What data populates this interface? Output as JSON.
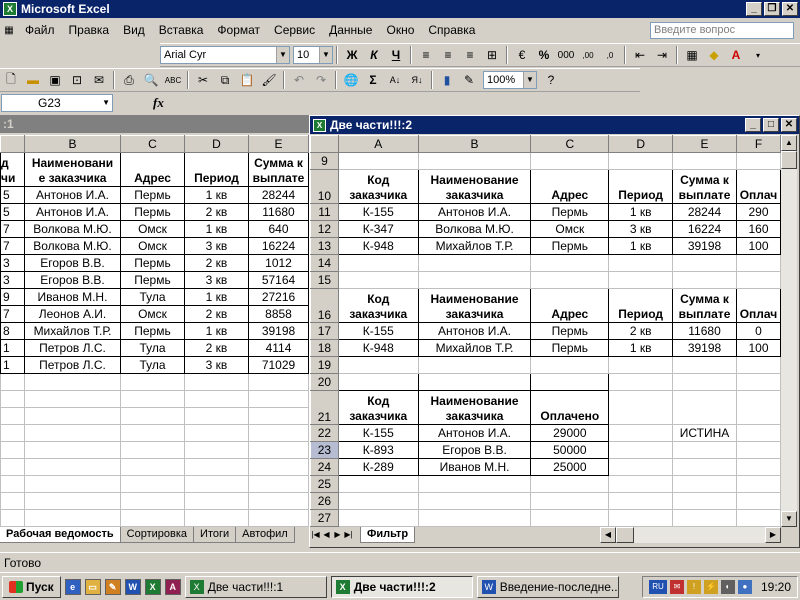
{
  "app": {
    "title": "Microsoft Excel"
  },
  "menu": [
    "Файл",
    "Правка",
    "Вид",
    "Вставка",
    "Формат",
    "Сервис",
    "Данные",
    "Окно",
    "Справка"
  ],
  "help_placeholder": "Введите вопрос",
  "format_toolbar": {
    "font": "Arial Cyr",
    "size": "10",
    "bold": "Ж",
    "italic": "К",
    "underline": "Ч"
  },
  "std_toolbar": {
    "zoom": "100%"
  },
  "formula_bar": {
    "name_box": "G23",
    "fx": "fx"
  },
  "left_window": {
    "title": ":1",
    "col_headers": [
      "",
      "B",
      "C",
      "D",
      "E"
    ],
    "partial_header": "д чи",
    "headers": [
      "Наименовани е заказчика",
      "Адрес",
      "Период",
      "Сумма к выплате"
    ],
    "rows": [
      [
        "5",
        "Антонов И.А.",
        "Пермь",
        "1 кв",
        "28244"
      ],
      [
        "5",
        "Антонов И.А.",
        "Пермь",
        "2 кв",
        "11680"
      ],
      [
        "7",
        "Волкова М.Ю.",
        "Омск",
        "1 кв",
        "640"
      ],
      [
        "7",
        "Волкова М.Ю.",
        "Омск",
        "3 кв",
        "16224"
      ],
      [
        "3",
        "Егоров В.В.",
        "Пермь",
        "2 кв",
        "1012"
      ],
      [
        "3",
        "Егоров В.В.",
        "Пермь",
        "3 кв",
        "57164"
      ],
      [
        "9",
        "Иванов М.Н.",
        "Тула",
        "1 кв",
        "27216"
      ],
      [
        "7",
        "Леонов А.И.",
        "Омск",
        "2 кв",
        "8858"
      ],
      [
        "8",
        "Михайлов Т.Р.",
        "Пермь",
        "1 кв",
        "39198"
      ],
      [
        "1",
        "Петров Л.С.",
        "Тула",
        "2 кв",
        "4114"
      ],
      [
        "1",
        "Петров Л.С.",
        "Тула",
        "3 кв",
        "71029"
      ]
    ],
    "tabs": [
      "Рабочая ведомость",
      "Сортировка",
      "Итоги",
      "Автофил"
    ]
  },
  "right_window": {
    "title": "Две части!!!:2",
    "col_headers": [
      "A",
      "B",
      "C",
      "D",
      "E",
      "F"
    ],
    "row_numbers": [
      "9",
      "10",
      "11",
      "12",
      "13",
      "14",
      "15",
      "16",
      "17",
      "18",
      "19",
      "20",
      "21",
      "22",
      "23",
      "24",
      "25",
      "26",
      "27"
    ],
    "block1_header": [
      "Код заказчика",
      "Наименование заказчика",
      "Адрес",
      "Период",
      "Сумма к выплате",
      "Оплачено"
    ],
    "block1_header_visible_f": "Оплач",
    "block1_rows": [
      [
        "К-155",
        "Антонов И.А.",
        "Пермь",
        "1 кв",
        "28244",
        "290"
      ],
      [
        "К-347",
        "Волкова М.Ю.",
        "Омск",
        "3 кв",
        "16224",
        "160"
      ],
      [
        "К-948",
        "Михайлов Т.Р.",
        "Пермь",
        "1 кв",
        "39198",
        "100"
      ]
    ],
    "block2_rows": [
      [
        "К-155",
        "Антонов И.А.",
        "Пермь",
        "2 кв",
        "11680",
        "0"
      ],
      [
        "К-948",
        "Михайлов Т.Р.",
        "Пермь",
        "1 кв",
        "39198",
        "100"
      ]
    ],
    "block3_header": [
      "Код заказчика",
      "Наименование заказчика",
      "Оплачено"
    ],
    "block3_rows": [
      [
        "К-155",
        "Антонов И.А.",
        "29000"
      ],
      [
        "К-893",
        "Егоров В.В.",
        "50000"
      ],
      [
        "К-289",
        "Иванов М.Н.",
        "25000"
      ]
    ],
    "e22": "ИСТИНА",
    "tab": "Фильтр"
  },
  "status": "Готово",
  "taskbar": {
    "start": "Пуск",
    "tasks": [
      "Две части!!!:1",
      "Две части!!!:2",
      "Введение-последне..."
    ],
    "lang": "RU",
    "clock": "19:20"
  }
}
